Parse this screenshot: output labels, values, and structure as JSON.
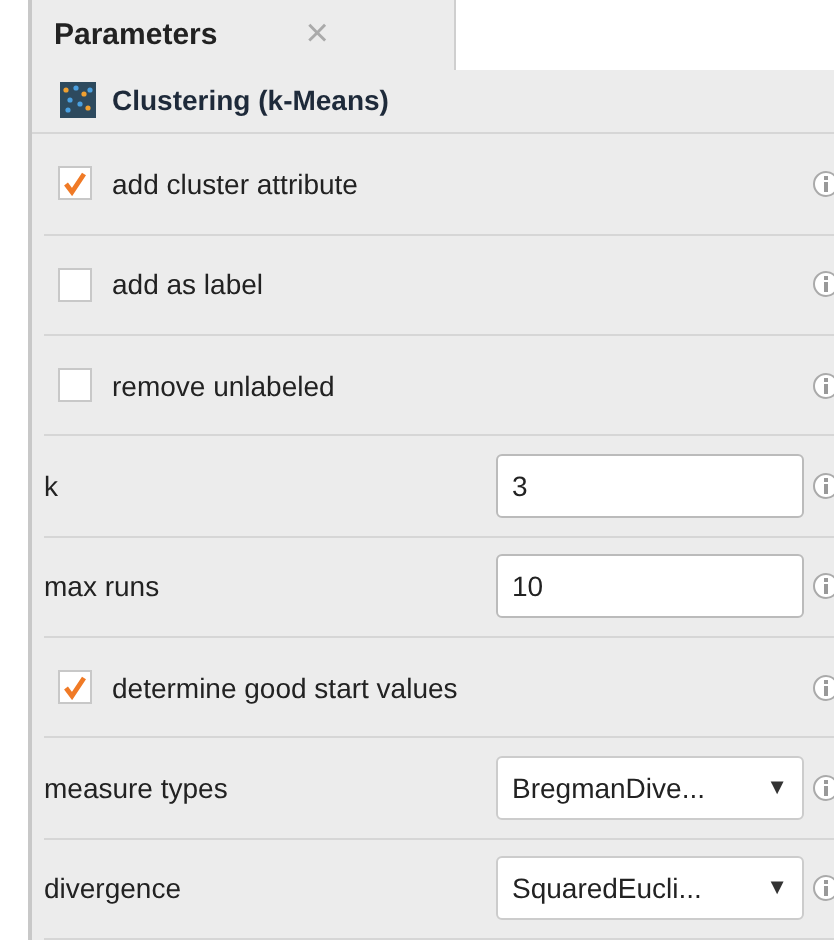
{
  "tab": {
    "label": "Parameters",
    "close": "×",
    "selected": true
  },
  "operator": {
    "name": "Clustering (k-Means)"
  },
  "parameters": [
    {
      "kind": "checkbox",
      "label": "add cluster attribute",
      "checked": true
    },
    {
      "kind": "checkbox",
      "label": "add as label",
      "checked": false
    },
    {
      "kind": "checkbox",
      "label": "remove unlabeled",
      "checked": false
    },
    {
      "kind": "number",
      "label": "k",
      "value": "3"
    },
    {
      "kind": "number",
      "label": "max runs",
      "value": "10"
    },
    {
      "kind": "checkbox",
      "label": "determine good start values",
      "checked": true
    },
    {
      "kind": "select",
      "label": "measure types",
      "value": "BregmanDive...",
      "caret": "▼"
    },
    {
      "kind": "select",
      "label": "divergence",
      "value": "SquaredEucli...",
      "caret": "▼"
    }
  ]
}
